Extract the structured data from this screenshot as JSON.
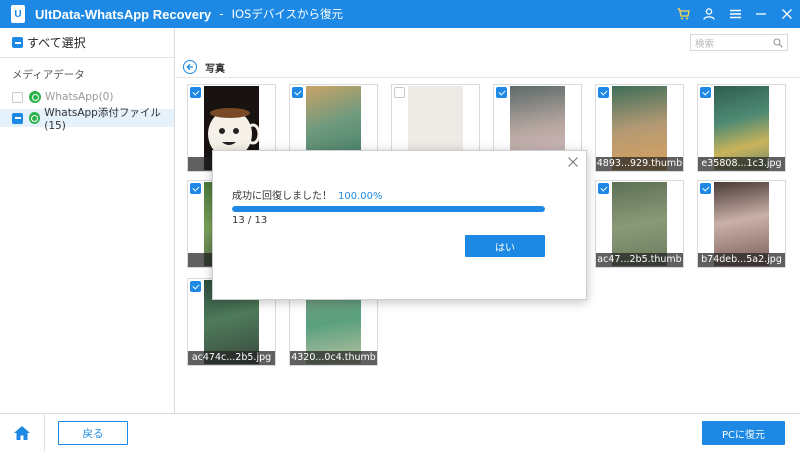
{
  "window": {
    "logo_letter": "U",
    "app_title": "UltData-WhatsApp Recovery",
    "separator": "-",
    "subtitle": "IOSデバイスから復元",
    "buttons": [
      "cart-icon",
      "user-icon",
      "menu-icon",
      "minimize-icon",
      "close-icon"
    ]
  },
  "sidebar": {
    "select_all_label": "すべて選択",
    "section_label": "メディアデータ",
    "items": [
      {
        "label": "WhatsApp(0)",
        "state": "unchecked",
        "disabled": true
      },
      {
        "label": "WhatsApp添付ファイル(15)",
        "state": "partial",
        "selected": true
      }
    ]
  },
  "search": {
    "placeholder": "検索"
  },
  "content": {
    "section_title": "写真",
    "thumbnails": [
      {
        "caption": "0a3",
        "checked": true
      },
      {
        "caption": "",
        "checked": true
      },
      {
        "caption": "",
        "checked": false
      },
      {
        "caption": "",
        "checked": true
      },
      {
        "caption": "4893...929.thumb",
        "checked": true
      },
      {
        "caption": "e35808...1c3.jpg",
        "checked": true
      },
      {
        "caption": "43",
        "checked": true
      },
      {
        "caption": "ac47...2b5.thumb",
        "checked": true
      },
      {
        "caption": "b74deb...5a2.jpg",
        "checked": true
      },
      {
        "caption": "ac474c...2b5.jpg",
        "checked": true
      },
      {
        "caption": "4320...0c4.thumb",
        "checked": false
      }
    ]
  },
  "dialog": {
    "status_text": "成功に回復しました！",
    "percent_text": "100.00%",
    "progress": 1.0,
    "count_text": "13 / 13",
    "ok_label": "はい"
  },
  "footer": {
    "back_label": "戻る",
    "recover_label": "PCに復元"
  },
  "colors": {
    "accent": "#1d89e4",
    "whatsapp_green": "#2bb24a"
  }
}
